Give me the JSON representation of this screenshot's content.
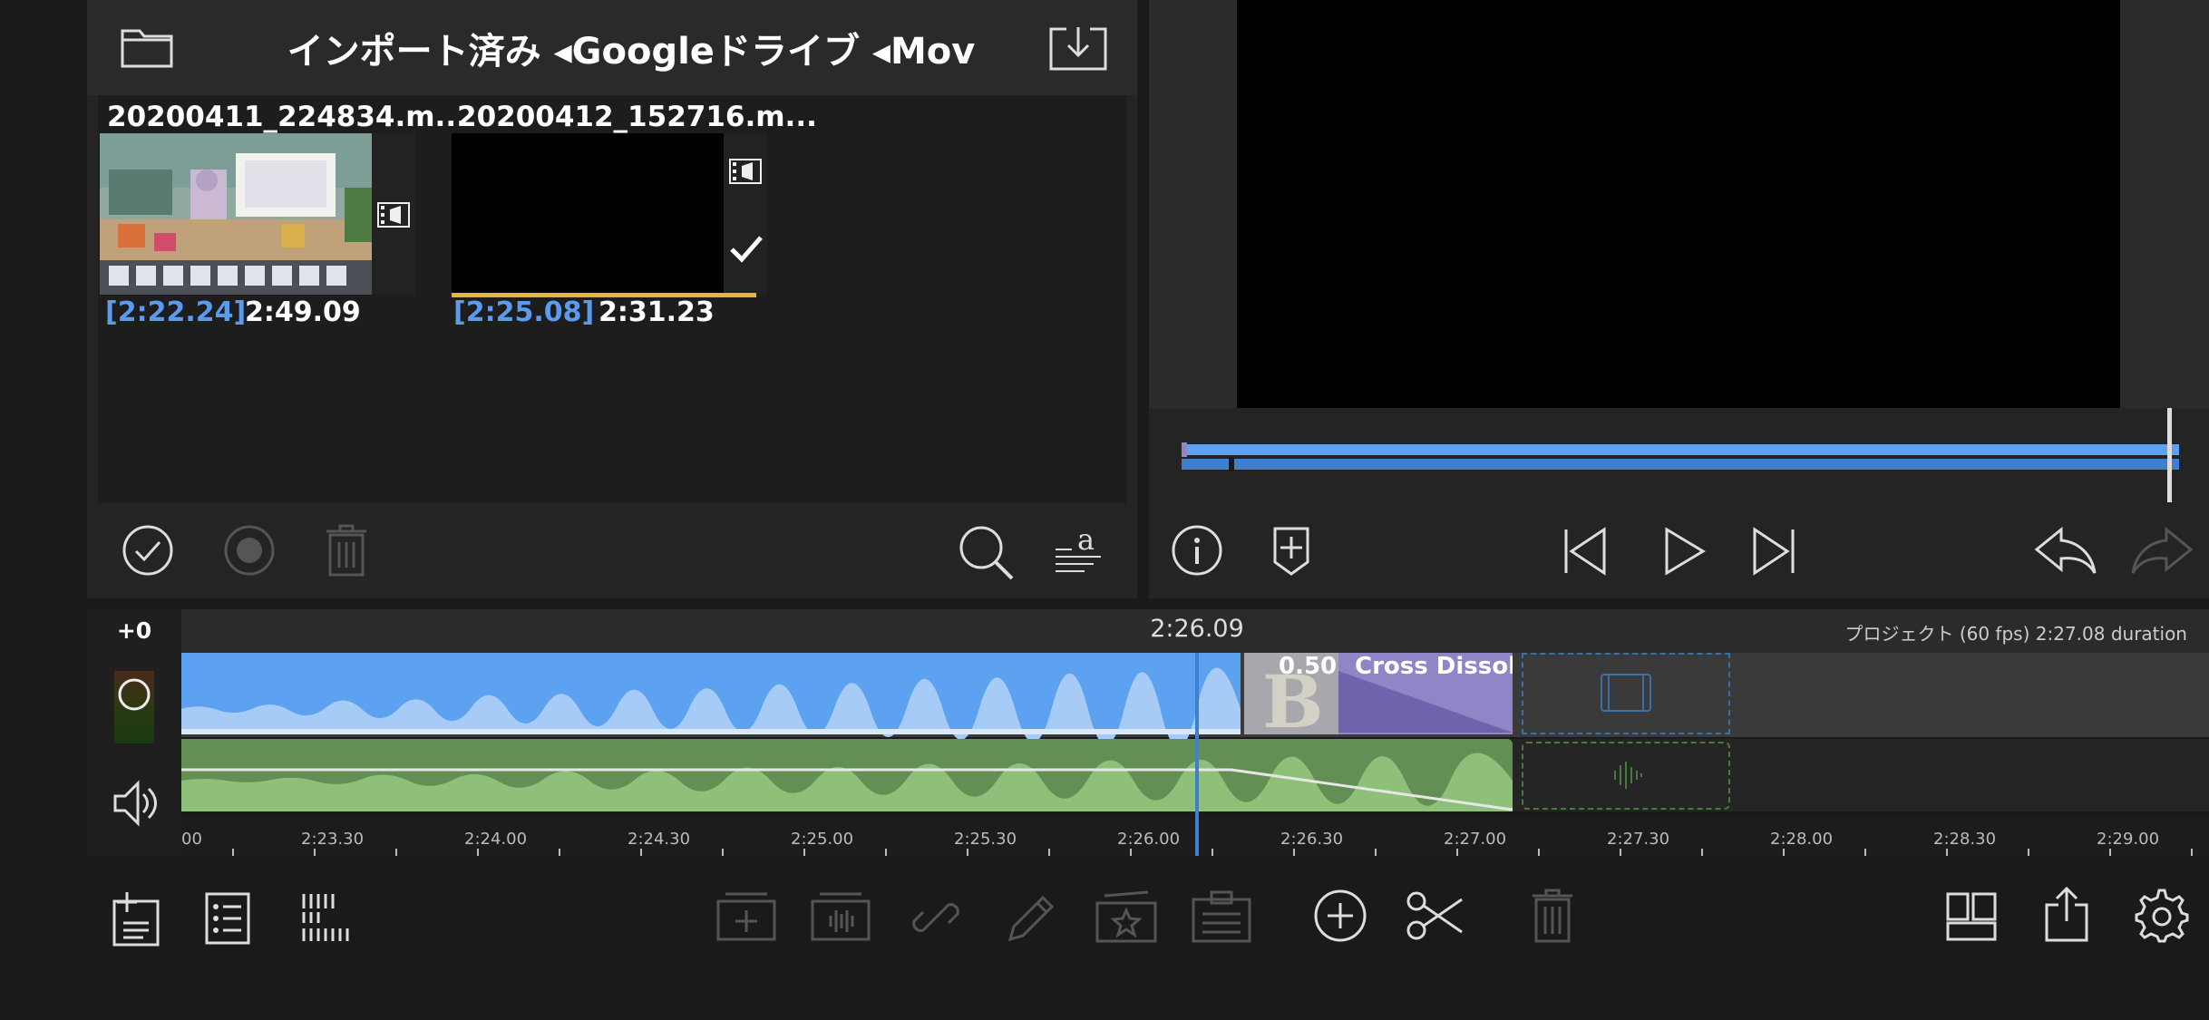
{
  "browser": {
    "title": "インポート済み ◂Googleドライブ ◂Mov",
    "clips": [
      {
        "name": "20200411_224834.m...",
        "in_point": "[2:22.24]",
        "duration": "2:49.09",
        "selected": false
      },
      {
        "name": "20200412_152716.m...",
        "in_point": "[2:25.08]",
        "duration": "2:31.23",
        "selected": true
      }
    ]
  },
  "timeline": {
    "offset": "+0",
    "playhead_time": "2:26.09",
    "project_info": "プロジェクト (60 fps)  2:27.08 duration",
    "transition": {
      "duration": "0.50",
      "label": "Cross Dissolve",
      "letter": "B"
    },
    "ruler_labels": [
      "00",
      "2:23.30",
      "2:24.00",
      "2:24.30",
      "2:25.00",
      "2:25.30",
      "2:26.00",
      "2:26.30",
      "2:27.00",
      "2:27.30",
      "2:28.00",
      "2:28.30",
      "2:29.00"
    ]
  },
  "colors": {
    "accent_blue": "#5a9bef",
    "video_clip": "#5da2f0",
    "audio_clip": "#648f54",
    "transition": "#8f85c7",
    "progress_yellow": "#e8b53a"
  },
  "icons": {
    "browser_header": [
      "folder-icon",
      "import-download-icon"
    ],
    "browser_toolbar": [
      "checkmark-circle-icon",
      "record-circle-icon",
      "trash-icon",
      "search-icon",
      "text-sort-icon"
    ],
    "viewer_toolbar": [
      "info-icon",
      "add-marker-icon",
      "skip-back-icon",
      "play-icon",
      "skip-forward-icon",
      "undo-icon",
      "redo-icon"
    ],
    "bottom_toolbar": [
      "add-title-icon",
      "list-icon",
      "waveform-grid-icon",
      "add-overlay-icon",
      "audio-overlay-icon",
      "link-icon",
      "pen-icon",
      "favorite-icon",
      "clipboard-icon",
      "add-icon",
      "scissors-icon",
      "trash-icon",
      "layout-icon",
      "share-icon",
      "settings-icon"
    ]
  }
}
